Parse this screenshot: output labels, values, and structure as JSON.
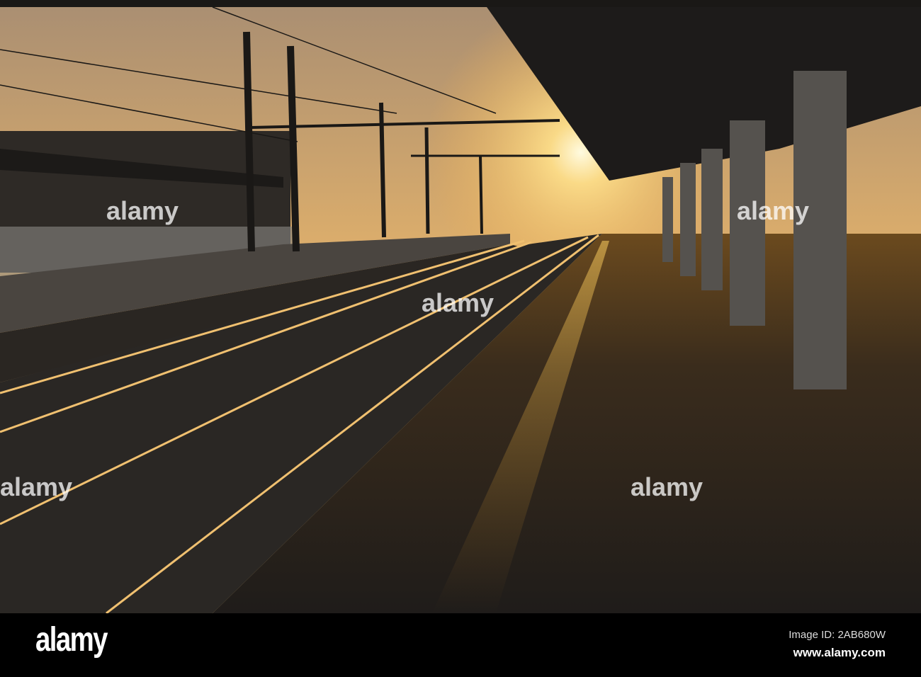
{
  "scene": "Railway station platform at sunset",
  "watermark": "alamy",
  "footer": {
    "logo": "alamy",
    "image_id": "Image ID: 2AB680W",
    "site": "www.alamy.com"
  }
}
